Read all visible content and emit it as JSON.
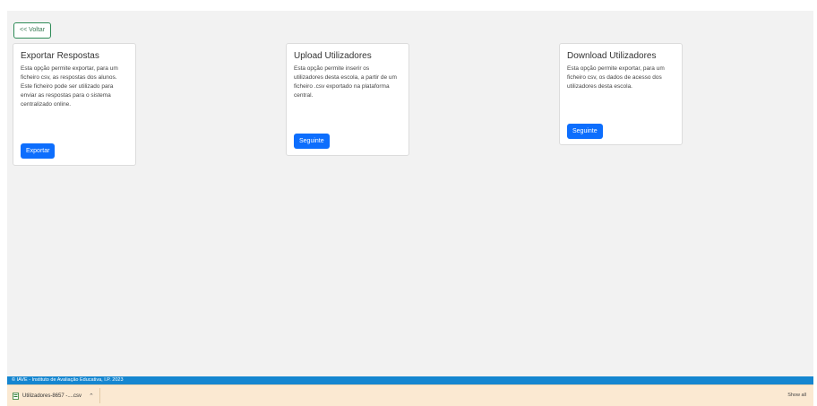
{
  "nav": {
    "back_label": "<< Voltar"
  },
  "cards": [
    {
      "title": "Exportar Respostas",
      "text": "Esta opção permite exportar, para um ficheiro csv, as respostas dos alunos. Este ficheiro pode ser utilizado para enviar as respostas para o sistema centralizado online.",
      "button": "Exportar"
    },
    {
      "title": "Upload Utilizadores",
      "text": "Esta opção permite inserir os utilizadores desta escola, a partir de um ficheiro .csv exportado na plataforma central.",
      "button": "Seguinte"
    },
    {
      "title": "Download Utilizadores",
      "text": "Esta opção permite exportar, para um ficheiro csv, os dados de acesso dos utilizadores desta escola.",
      "button": "Seguinte"
    }
  ],
  "footer": {
    "text": "© IAVE - Instituto de Avaliação Educativa, I.P. 2023"
  },
  "downloads": {
    "file_name": "Utilizadores-8657 -....csv",
    "show_all": "Show all"
  },
  "colors": {
    "primary": "#0d6efd",
    "footer": "#1586d0",
    "back_border": "#2e8b57",
    "downloads_bg": "#fbe9d2"
  },
  "icons": {
    "download_file": "file-icon",
    "chevron": "chevron-up-icon"
  }
}
